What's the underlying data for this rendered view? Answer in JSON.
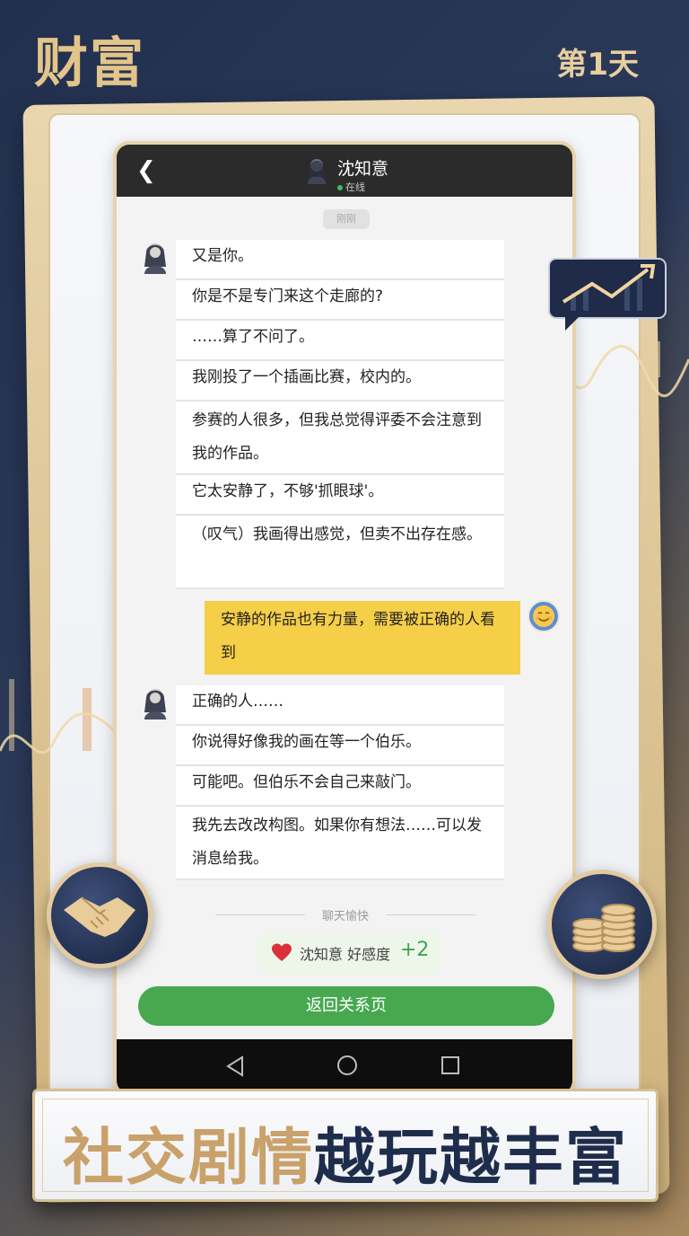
{
  "header": {
    "app_title": "财富",
    "day_label": "第1天"
  },
  "chat": {
    "contact_name": "沈知意",
    "status": "在线",
    "time_label": "刚刚",
    "incoming_group_1": [
      "又是你。",
      "你是不是专门来这个走廊的?",
      "……算了不问了。",
      "我刚投了一个插画比赛，校内的。",
      "参赛的人很多，但我总觉得评委不会注意到我的作品。",
      "它太安静了，不够'抓眼球'。",
      "（叹气）我画得出感觉，但卖不出存在感。"
    ],
    "outgoing": "安静的作品也有力量，需要被正确的人看到",
    "incoming_group_2": [
      "正确的人……",
      "你说得好像我的画在等一个伯乐。",
      "可能吧。但伯乐不会自己来敲门。",
      "我先去改改构图。如果你有想法……可以发消息给我。"
    ],
    "divider_label": "聊天愉快",
    "favor_text": "沈知意 好感度",
    "favor_delta": "+2",
    "return_button": "返回关系页"
  },
  "banner": {
    "part1": "社交剧情",
    "part2": "越玩越丰富"
  },
  "colors": {
    "gold": "#e3c48a",
    "navy": "#1f2d4c",
    "my_bubble": "#f5cf47",
    "button_green": "#47a84f"
  }
}
